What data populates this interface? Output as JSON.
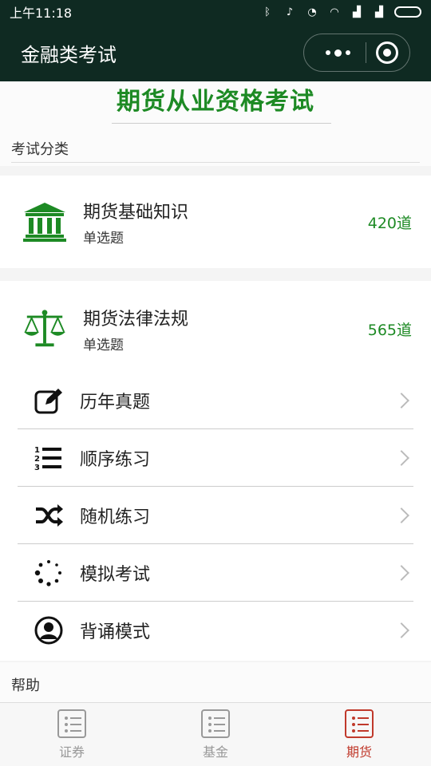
{
  "status_bar": {
    "time": "上午11:18"
  },
  "nav": {
    "title": "金融类考试"
  },
  "page": {
    "heading": "期货从业资格考试"
  },
  "sections": {
    "category": "考试分类",
    "help": "帮助"
  },
  "categories": [
    {
      "name": "期货基础知识",
      "type": "单选题",
      "count": "420道",
      "icon": "bank-icon"
    },
    {
      "name": "期货法律法规",
      "type": "单选题",
      "count": "565道",
      "icon": "scales-icon"
    }
  ],
  "menu": [
    {
      "label": "历年真题",
      "icon": "edit-icon"
    },
    {
      "label": "顺序练习",
      "icon": "ordered-list-icon"
    },
    {
      "label": "随机练习",
      "icon": "shuffle-icon"
    },
    {
      "label": "模拟考试",
      "icon": "loading-dots-icon"
    },
    {
      "label": "背诵模式",
      "icon": "user-circle-icon"
    }
  ],
  "tabs": [
    {
      "label": "证券",
      "active": false
    },
    {
      "label": "基金",
      "active": false
    },
    {
      "label": "期货",
      "active": true
    }
  ],
  "colors": {
    "nav_bg": "#0f2a22",
    "accent_green": "#1d8a24",
    "active_tab": "#c0392b"
  }
}
